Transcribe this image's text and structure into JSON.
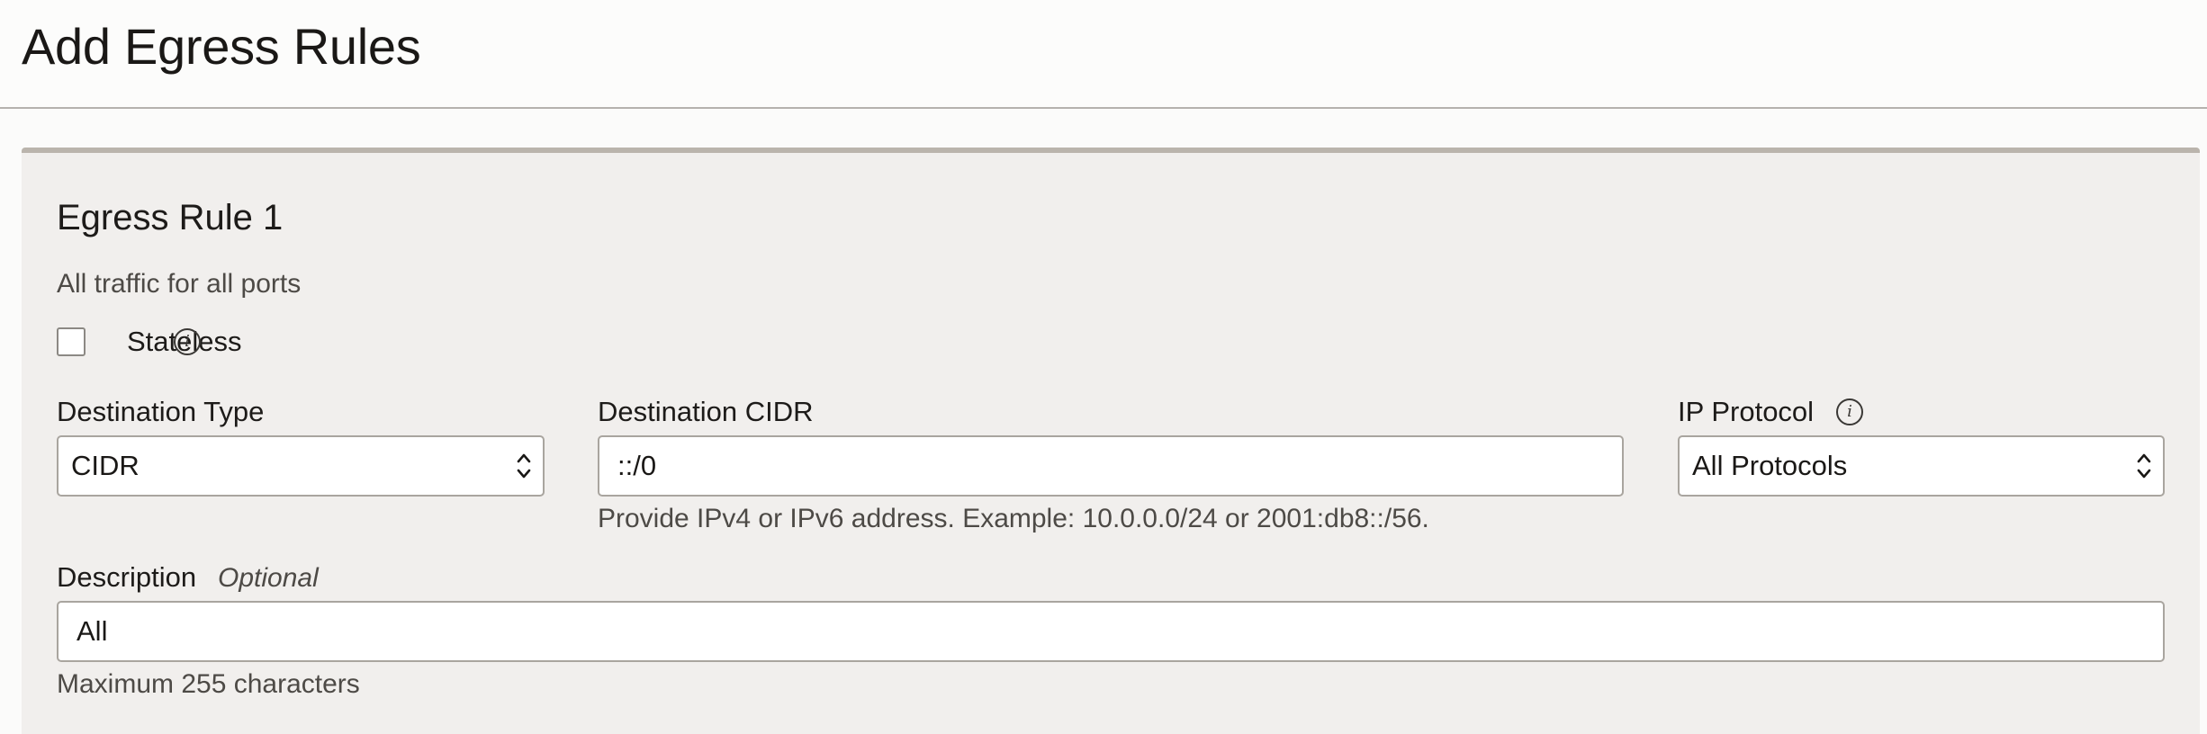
{
  "header": {
    "title": "Add Egress Rules"
  },
  "rule": {
    "title": "Egress Rule 1",
    "subtitle": "All traffic for all ports",
    "stateless": {
      "label": "Stateless",
      "checked": false,
      "info_icon": "info-icon"
    },
    "destination_type": {
      "label": "Destination Type",
      "value": "CIDR"
    },
    "destination_cidr": {
      "label": "Destination CIDR",
      "value": "::/0",
      "helper": "Provide IPv4 or IPv6 address. Example: 10.0.0.0/24 or 2001:db8::/56."
    },
    "ip_protocol": {
      "label": "IP Protocol",
      "value": "All Protocols",
      "info_icon": "info-icon"
    },
    "description": {
      "label": "Description",
      "optional": "Optional",
      "value": "All",
      "helper": "Maximum 255 characters"
    }
  },
  "colors": {
    "panel_background": "#f1efed",
    "panel_top_border": "#bab4ac",
    "input_border": "#a9a59f",
    "text_primary": "#1d1b19",
    "text_secondary": "#4d4a46"
  }
}
